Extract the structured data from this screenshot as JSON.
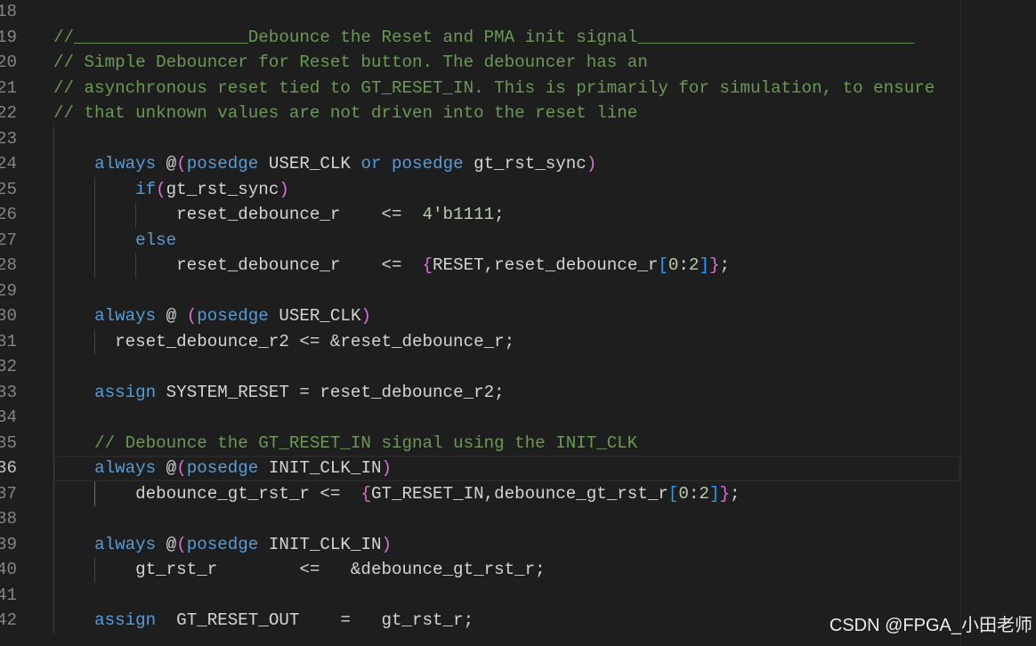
{
  "editor": {
    "colors": {
      "background": "#1e1e1e",
      "text": "#d4d4d4",
      "keyword": "#569cd6",
      "comment": "#6a9955",
      "number": "#b5cea8",
      "bracket_level_1": "#da70d6",
      "bracket_level_2": "#179fff",
      "line_number": "#858585",
      "line_number_active": "#c6c6c6",
      "indent_guide": "#404040",
      "indent_guide_active": "#707070",
      "current_line_border": "#282828"
    },
    "active_line": 36,
    "lines": [
      {
        "number": "18",
        "tokens": []
      },
      {
        "number": "19",
        "tokens": [
          {
            "text": "//_________________Debounce the Reset and PMA init signal___________________________",
            "kind": "comment"
          }
        ]
      },
      {
        "number": "20",
        "tokens": [
          {
            "text": "// Simple Debouncer for Reset button. The debouncer has an",
            "kind": "comment"
          }
        ]
      },
      {
        "number": "21",
        "tokens": [
          {
            "text": "// asynchronous reset tied to GT_RESET_IN. This is primarily for simulation, to ensure",
            "kind": "comment"
          }
        ]
      },
      {
        "number": "22",
        "tokens": [
          {
            "text": "// that unknown values are not driven into the reset line",
            "kind": "comment"
          }
        ]
      },
      {
        "number": "23",
        "tokens": []
      },
      {
        "number": "24",
        "tokens": [
          {
            "text": "    ",
            "kind": "text"
          },
          {
            "text": "always",
            "kind": "keyword"
          },
          {
            "text": " @",
            "kind": "text"
          },
          {
            "text": "(",
            "kind": "bracket_level_1"
          },
          {
            "text": "posedge",
            "kind": "keyword"
          },
          {
            "text": " USER_CLK ",
            "kind": "text"
          },
          {
            "text": "or",
            "kind": "keyword"
          },
          {
            "text": " ",
            "kind": "text"
          },
          {
            "text": "posedge",
            "kind": "keyword"
          },
          {
            "text": " gt_rst_sync",
            "kind": "text"
          },
          {
            "text": ")",
            "kind": "bracket_level_1"
          }
        ]
      },
      {
        "number": "25",
        "tokens": [
          {
            "text": "        ",
            "kind": "text"
          },
          {
            "text": "if",
            "kind": "keyword"
          },
          {
            "text": "(",
            "kind": "bracket_level_1"
          },
          {
            "text": "gt_rst_sync",
            "kind": "text"
          },
          {
            "text": ")",
            "kind": "bracket_level_1"
          }
        ]
      },
      {
        "number": "26",
        "tokens": [
          {
            "text": "            reset_debounce_r    <=  ",
            "kind": "text"
          },
          {
            "text": "4'b1111",
            "kind": "number"
          },
          {
            "text": ";",
            "kind": "text"
          }
        ]
      },
      {
        "number": "27",
        "tokens": [
          {
            "text": "        ",
            "kind": "text"
          },
          {
            "text": "else",
            "kind": "keyword"
          }
        ]
      },
      {
        "number": "28",
        "tokens": [
          {
            "text": "            reset_debounce_r    <=  ",
            "kind": "text"
          },
          {
            "text": "{",
            "kind": "bracket_level_1"
          },
          {
            "text": "RESET,reset_debounce_r",
            "kind": "text"
          },
          {
            "text": "[",
            "kind": "bracket_level_2"
          },
          {
            "text": "0",
            "kind": "number"
          },
          {
            "text": ":",
            "kind": "text"
          },
          {
            "text": "2",
            "kind": "number"
          },
          {
            "text": "]",
            "kind": "bracket_level_2"
          },
          {
            "text": "}",
            "kind": "bracket_level_1"
          },
          {
            "text": ";",
            "kind": "text"
          }
        ]
      },
      {
        "number": "29",
        "tokens": []
      },
      {
        "number": "30",
        "tokens": [
          {
            "text": "    ",
            "kind": "text"
          },
          {
            "text": "always",
            "kind": "keyword"
          },
          {
            "text": " @ ",
            "kind": "text"
          },
          {
            "text": "(",
            "kind": "bracket_level_1"
          },
          {
            "text": "posedge",
            "kind": "keyword"
          },
          {
            "text": " USER_CLK",
            "kind": "text"
          },
          {
            "text": ")",
            "kind": "bracket_level_1"
          }
        ]
      },
      {
        "number": "31",
        "tokens": [
          {
            "text": "      reset_debounce_r2 <= &reset_debounce_r;",
            "kind": "text"
          }
        ]
      },
      {
        "number": "32",
        "tokens": []
      },
      {
        "number": "33",
        "tokens": [
          {
            "text": "    ",
            "kind": "text"
          },
          {
            "text": "assign",
            "kind": "keyword"
          },
          {
            "text": " SYSTEM_RESET = reset_debounce_r2;",
            "kind": "text"
          }
        ]
      },
      {
        "number": "34",
        "tokens": []
      },
      {
        "number": "35",
        "tokens": [
          {
            "text": "    ",
            "kind": "text"
          },
          {
            "text": "// Debounce the GT_RESET_IN signal using the INIT_CLK",
            "kind": "comment"
          }
        ]
      },
      {
        "number": "36",
        "tokens": [
          {
            "text": "    ",
            "kind": "text"
          },
          {
            "text": "always",
            "kind": "keyword"
          },
          {
            "text": " @",
            "kind": "text"
          },
          {
            "text": "(",
            "kind": "bracket_level_1"
          },
          {
            "text": "posedge",
            "kind": "keyword"
          },
          {
            "text": " INIT_CLK_IN",
            "kind": "text"
          },
          {
            "text": ")",
            "kind": "bracket_level_1"
          }
        ]
      },
      {
        "number": "37",
        "tokens": [
          {
            "text": "        debounce_gt_rst_r <=  ",
            "kind": "text"
          },
          {
            "text": "{",
            "kind": "bracket_level_1"
          },
          {
            "text": "GT_RESET_IN,debounce_gt_rst_r",
            "kind": "text"
          },
          {
            "text": "[",
            "kind": "bracket_level_2"
          },
          {
            "text": "0",
            "kind": "number"
          },
          {
            "text": ":",
            "kind": "text"
          },
          {
            "text": "2",
            "kind": "number"
          },
          {
            "text": "]",
            "kind": "bracket_level_2"
          },
          {
            "text": "}",
            "kind": "bracket_level_1"
          },
          {
            "text": ";",
            "kind": "text"
          }
        ]
      },
      {
        "number": "38",
        "tokens": []
      },
      {
        "number": "39",
        "tokens": [
          {
            "text": "    ",
            "kind": "text"
          },
          {
            "text": "always",
            "kind": "keyword"
          },
          {
            "text": " @",
            "kind": "text"
          },
          {
            "text": "(",
            "kind": "bracket_level_1"
          },
          {
            "text": "posedge",
            "kind": "keyword"
          },
          {
            "text": " INIT_CLK_IN",
            "kind": "text"
          },
          {
            "text": ")",
            "kind": "bracket_level_1"
          }
        ]
      },
      {
        "number": "40",
        "tokens": [
          {
            "text": "        gt_rst_r        <=   &debounce_gt_rst_r;",
            "kind": "text"
          }
        ]
      },
      {
        "number": "41",
        "tokens": []
      },
      {
        "number": "42",
        "tokens": [
          {
            "text": "    ",
            "kind": "text"
          },
          {
            "text": "assign",
            "kind": "keyword"
          },
          {
            "text": "  GT_RESET_OUT    =   gt_rst_r;",
            "kind": "text"
          }
        ]
      }
    ]
  },
  "watermark": "CSDN @FPGA_小田老师"
}
